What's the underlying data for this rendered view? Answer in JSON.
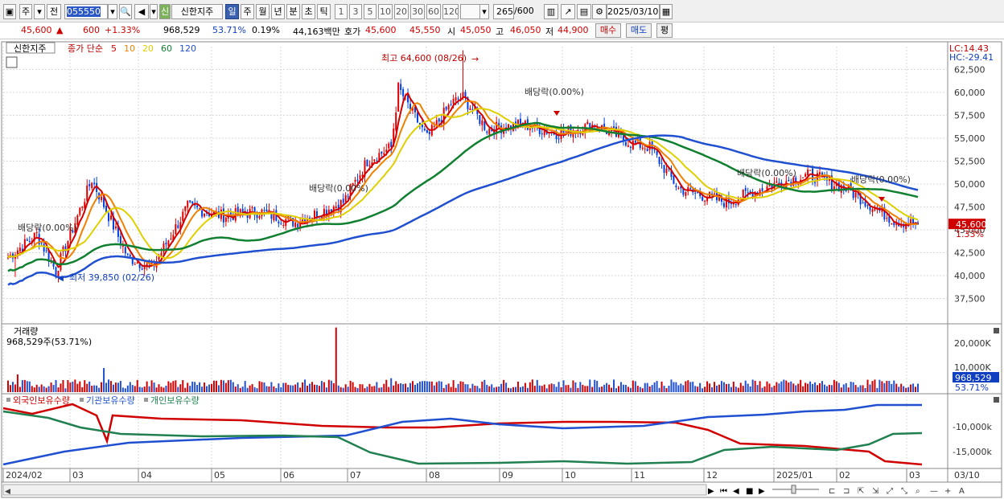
{
  "toolbar": {
    "market": "주",
    "prev": "전",
    "code": "055550",
    "name": "신한지주",
    "name_badge": "신",
    "periods": [
      "일",
      "주",
      "월",
      "년",
      "분",
      "초",
      "틱"
    ],
    "selected_period": "일",
    "intervals": [
      "1",
      "3",
      "5",
      "10",
      "20",
      "30",
      "60",
      "120"
    ],
    "count": "265",
    "count_total": "/600",
    "date": "2025/03/10"
  },
  "quote": {
    "price": "45,600",
    "change": "600",
    "change_pct": "+1.33%",
    "volume": "968,529",
    "volume_ratio": "53.71%",
    "turnover": "0.19%",
    "amount": "44,163백만",
    "bid_label": "호가",
    "ask": "45,600",
    "bid": "45,550",
    "open_label": "시",
    "open": "45,050",
    "high_label": "고",
    "high": "46,050",
    "low_label": "저",
    "low": "44,900",
    "buy": "매수",
    "sell": "매도",
    "even": "평"
  },
  "price_panel": {
    "tab": "신한지주",
    "ma_label": "종가 단순",
    "ma_periods": [
      "5",
      "10",
      "20",
      "60",
      "120"
    ],
    "ma_colors": [
      "#d40000",
      "#f08000",
      "#e0d000",
      "#108030",
      "#2050d0"
    ],
    "lc": "LC:14.43",
    "hc": "HC:-29.41",
    "last_price": "45,600",
    "last_pct": "1.33%",
    "y_ticks": [
      "62,500",
      "60,000",
      "57,500",
      "55,000",
      "52,500",
      "50,000",
      "47,500",
      "45,000",
      "42,500",
      "40,000",
      "37,500"
    ],
    "annot_high": "최고 64,600 (08/26)",
    "annot_low": "최저 39,850 (02/26)",
    "dividends": [
      "배당락(0.00%)",
      "배당락(0.00%)",
      "배당락(0.00%)",
      "배당락(0.00%)",
      "배당락(0.00%)"
    ]
  },
  "volume_panel": {
    "title": "거래량",
    "value": "968,529주(53.71%)",
    "y_ticks": [
      "20,000K",
      "10,000K"
    ],
    "last": "968,529",
    "last_pct": "53.71%"
  },
  "holding_panel": {
    "legend": [
      "외국인보유수량",
      "기관보유수량",
      "개인보유수량"
    ],
    "colors": [
      "#d00000",
      "#2050d0",
      "#208050"
    ],
    "y_ticks": [
      "-10,000k",
      "-15,000k"
    ]
  },
  "x_axis": {
    "labels": [
      "2024/02",
      "03",
      "04",
      "05",
      "06",
      "07",
      "08",
      "09",
      "10",
      "11",
      "12",
      "2025/01",
      "02",
      "03"
    ],
    "right_label": "03/10"
  },
  "chart_data": {
    "type": "candlestick",
    "title": "신한지주",
    "ylim": [
      35000,
      65000
    ],
    "ma": [
      {
        "name": "5",
        "color": "#d40000"
      },
      {
        "name": "10",
        "color": "#f08000"
      },
      {
        "name": "20",
        "color": "#e0d000"
      },
      {
        "name": "60",
        "color": "#108030"
      },
      {
        "name": "120",
        "color": "#2050d0"
      }
    ],
    "close_keypoints": [
      [
        0,
        42000
      ],
      [
        12,
        44500
      ],
      [
        20,
        40500
      ],
      [
        35,
        50500
      ],
      [
        50,
        42000
      ],
      [
        60,
        40800
      ],
      [
        75,
        47500
      ],
      [
        90,
        46500
      ],
      [
        105,
        47000
      ],
      [
        120,
        45800
      ],
      [
        140,
        48000
      ],
      [
        150,
        52500
      ],
      [
        160,
        54000
      ],
      [
        163,
        60500
      ],
      [
        175,
        55000
      ],
      [
        185,
        58800
      ],
      [
        190,
        59500
      ],
      [
        200,
        56000
      ],
      [
        215,
        56500
      ],
      [
        230,
        55500
      ],
      [
        245,
        56500
      ],
      [
        260,
        54500
      ],
      [
        268,
        54000
      ],
      [
        280,
        49500
      ],
      [
        300,
        48000
      ],
      [
        320,
        50000
      ],
      [
        335,
        51000
      ],
      [
        350,
        49500
      ],
      [
        370,
        46000
      ],
      [
        380,
        45600
      ]
    ],
    "high": 64600,
    "low": 39850,
    "last": 45600
  }
}
